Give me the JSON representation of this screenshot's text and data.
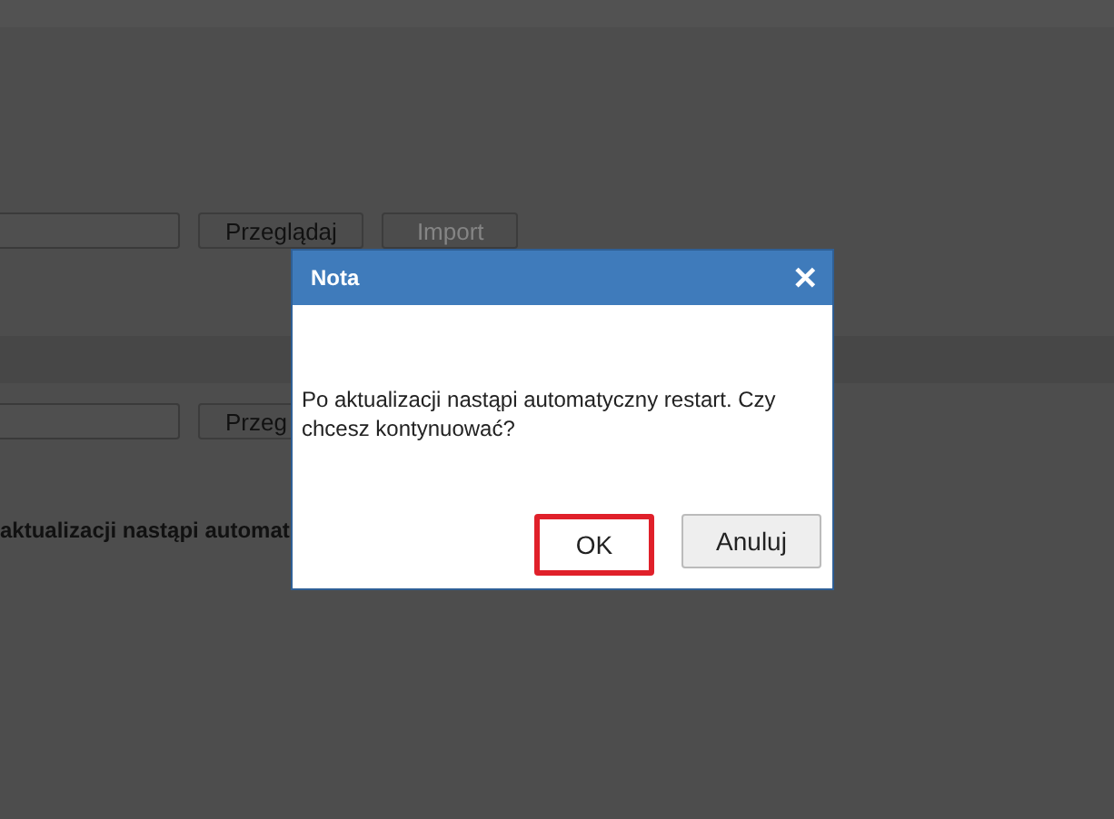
{
  "page": {
    "rows": [
      {
        "button": "Przeglądaj",
        "second_button": {
          "label": "Import",
          "disabled": true
        }
      },
      {
        "button": "Przeg"
      }
    ],
    "note": "aktualizacji nastąpi automat"
  },
  "dialog": {
    "title": "Nota",
    "close": "✕",
    "message": "Po aktualizacji nastąpi automatyczny restart. Czy chcesz kontynuować?",
    "buttons": [
      {
        "label": "OK",
        "highlighted": true
      },
      {
        "label": "Anuluj",
        "highlighted": false
      }
    ]
  }
}
